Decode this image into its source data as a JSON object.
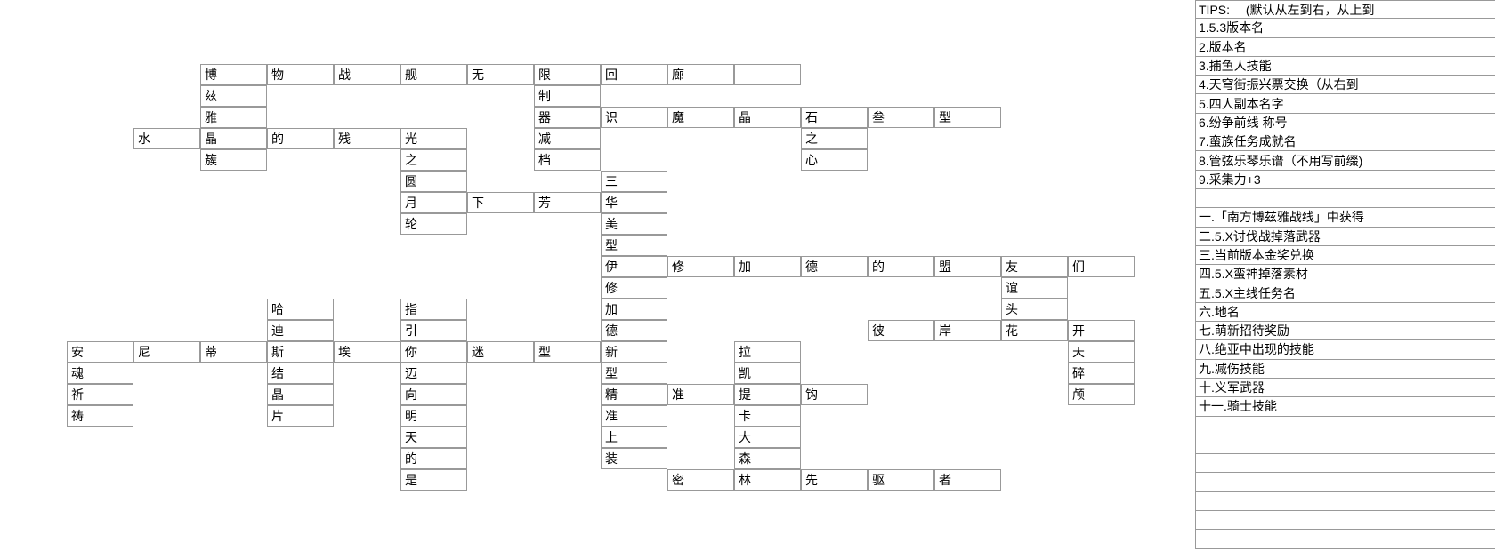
{
  "crossword": {
    "cells": [
      {
        "c": 3,
        "r": 3,
        "t": "博"
      },
      {
        "c": 4,
        "r": 3,
        "t": "物"
      },
      {
        "c": 5,
        "r": 3,
        "t": "战"
      },
      {
        "c": 6,
        "r": 3,
        "t": "舰"
      },
      {
        "c": 7,
        "r": 3,
        "t": "无"
      },
      {
        "c": 8,
        "r": 3,
        "t": "限"
      },
      {
        "c": 9,
        "r": 3,
        "t": "回"
      },
      {
        "c": 10,
        "r": 3,
        "t": "廊"
      },
      {
        "c": 11,
        "r": 3,
        "t": ""
      },
      {
        "c": 3,
        "r": 4,
        "t": "兹"
      },
      {
        "c": 8,
        "r": 4,
        "t": "制"
      },
      {
        "c": 3,
        "r": 5,
        "t": "雅"
      },
      {
        "c": 8,
        "r": 5,
        "t": "器"
      },
      {
        "c": 9,
        "r": 5,
        "t": "识"
      },
      {
        "c": 10,
        "r": 5,
        "t": "魔"
      },
      {
        "c": 11,
        "r": 5,
        "t": "晶"
      },
      {
        "c": 12,
        "r": 5,
        "t": "石"
      },
      {
        "c": 13,
        "r": 5,
        "t": "叁"
      },
      {
        "c": 14,
        "r": 5,
        "t": "型"
      },
      {
        "c": 2,
        "r": 6,
        "t": "水"
      },
      {
        "c": 3,
        "r": 6,
        "t": "晶"
      },
      {
        "c": 4,
        "r": 6,
        "t": "的"
      },
      {
        "c": 5,
        "r": 6,
        "t": "残"
      },
      {
        "c": 6,
        "r": 6,
        "t": "光"
      },
      {
        "c": 8,
        "r": 6,
        "t": "减"
      },
      {
        "c": 12,
        "r": 6,
        "t": "之"
      },
      {
        "c": 3,
        "r": 7,
        "t": "簇"
      },
      {
        "c": 6,
        "r": 7,
        "t": "之"
      },
      {
        "c": 8,
        "r": 7,
        "t": "档"
      },
      {
        "c": 12,
        "r": 7,
        "t": "心"
      },
      {
        "c": 6,
        "r": 8,
        "t": "圆"
      },
      {
        "c": 9,
        "r": 8,
        "t": "三"
      },
      {
        "c": 6,
        "r": 9,
        "t": "月"
      },
      {
        "c": 7,
        "r": 9,
        "t": "下"
      },
      {
        "c": 8,
        "r": 9,
        "t": "芳"
      },
      {
        "c": 9,
        "r": 9,
        "t": "华"
      },
      {
        "c": 6,
        "r": 10,
        "t": "轮"
      },
      {
        "c": 9,
        "r": 10,
        "t": "美"
      },
      {
        "c": 9,
        "r": 11,
        "t": "型"
      },
      {
        "c": 9,
        "r": 12,
        "t": "伊"
      },
      {
        "c": 10,
        "r": 12,
        "t": "修"
      },
      {
        "c": 11,
        "r": 12,
        "t": "加"
      },
      {
        "c": 12,
        "r": 12,
        "t": "德"
      },
      {
        "c": 13,
        "r": 12,
        "t": "的"
      },
      {
        "c": 14,
        "r": 12,
        "t": "盟"
      },
      {
        "c": 15,
        "r": 12,
        "t": "友"
      },
      {
        "c": 16,
        "r": 12,
        "t": "们"
      },
      {
        "c": 9,
        "r": 13,
        "t": "修"
      },
      {
        "c": 15,
        "r": 13,
        "t": "谊"
      },
      {
        "c": 4,
        "r": 14,
        "t": "哈"
      },
      {
        "c": 6,
        "r": 14,
        "t": "指"
      },
      {
        "c": 9,
        "r": 14,
        "t": "加"
      },
      {
        "c": 15,
        "r": 14,
        "t": "头"
      },
      {
        "c": 4,
        "r": 15,
        "t": "迪"
      },
      {
        "c": 6,
        "r": 15,
        "t": "引"
      },
      {
        "c": 9,
        "r": 15,
        "t": "德"
      },
      {
        "c": 13,
        "r": 15,
        "t": "彼"
      },
      {
        "c": 14,
        "r": 15,
        "t": "岸"
      },
      {
        "c": 15,
        "r": 15,
        "t": "花"
      },
      {
        "c": 16,
        "r": 15,
        "t": "开"
      },
      {
        "c": 1,
        "r": 16,
        "t": "安"
      },
      {
        "c": 2,
        "r": 16,
        "t": "尼"
      },
      {
        "c": 3,
        "r": 16,
        "t": "蒂"
      },
      {
        "c": 4,
        "r": 16,
        "t": "斯"
      },
      {
        "c": 5,
        "r": 16,
        "t": "埃"
      },
      {
        "c": 6,
        "r": 16,
        "t": "你"
      },
      {
        "c": 7,
        "r": 16,
        "t": "迷"
      },
      {
        "c": 8,
        "r": 16,
        "t": "型"
      },
      {
        "c": 9,
        "r": 16,
        "t": "新"
      },
      {
        "c": 11,
        "r": 16,
        "t": "拉"
      },
      {
        "c": 16,
        "r": 16,
        "t": "天"
      },
      {
        "c": 1,
        "r": 17,
        "t": "魂"
      },
      {
        "c": 4,
        "r": 17,
        "t": "结"
      },
      {
        "c": 6,
        "r": 17,
        "t": "迈"
      },
      {
        "c": 9,
        "r": 17,
        "t": "型"
      },
      {
        "c": 11,
        "r": 17,
        "t": "凯"
      },
      {
        "c": 16,
        "r": 17,
        "t": "碎"
      },
      {
        "c": 1,
        "r": 18,
        "t": "祈"
      },
      {
        "c": 4,
        "r": 18,
        "t": "晶"
      },
      {
        "c": 6,
        "r": 18,
        "t": "向"
      },
      {
        "c": 9,
        "r": 18,
        "t": "精"
      },
      {
        "c": 10,
        "r": 18,
        "t": "准"
      },
      {
        "c": 11,
        "r": 18,
        "t": "提"
      },
      {
        "c": 12,
        "r": 18,
        "t": "钩"
      },
      {
        "c": 16,
        "r": 18,
        "t": "颅"
      },
      {
        "c": 1,
        "r": 19,
        "t": "祷"
      },
      {
        "c": 4,
        "r": 19,
        "t": "片"
      },
      {
        "c": 6,
        "r": 19,
        "t": "明"
      },
      {
        "c": 9,
        "r": 19,
        "t": "准"
      },
      {
        "c": 11,
        "r": 19,
        "t": "卡"
      },
      {
        "c": 6,
        "r": 20,
        "t": "天"
      },
      {
        "c": 9,
        "r": 20,
        "t": "上"
      },
      {
        "c": 11,
        "r": 20,
        "t": "大"
      },
      {
        "c": 6,
        "r": 21,
        "t": "的"
      },
      {
        "c": 9,
        "r": 21,
        "t": "装"
      },
      {
        "c": 11,
        "r": 21,
        "t": "森"
      },
      {
        "c": 6,
        "r": 22,
        "t": "是"
      },
      {
        "c": 10,
        "r": 22,
        "t": "密"
      },
      {
        "c": 11,
        "r": 22,
        "t": "林"
      },
      {
        "c": 12,
        "r": 22,
        "t": "先"
      },
      {
        "c": 13,
        "r": 22,
        "t": "驱"
      },
      {
        "c": 14,
        "r": 22,
        "t": "者"
      }
    ]
  },
  "tips": {
    "header": "TIPS:　 (默认从左到右，从上到",
    "rows": [
      "1.5.3版本名",
      "2.版本名",
      "3.捕鱼人技能",
      "4.天穹街振兴票交换（从右到",
      "5.四人副本名字",
      "6.纷争前线 称号",
      "7.蛮族任务成就名",
      "8.管弦乐琴乐谱（不用写前缀)",
      "9.采集力+3",
      "",
      "一.「南方博兹雅战线」中获得",
      "二.5.X讨伐战掉落武器",
      "三.当前版本金奖兑换",
      "四.5.X蛮神掉落素材",
      "五.5.X主线任务名",
      "六.地名",
      "七.萌新招待奖励",
      "八.绝亚中出现的技能",
      "九.减伤技能",
      "十.义军武器",
      "十一.骑士技能",
      "",
      "",
      "",
      "",
      "",
      "",
      ""
    ]
  }
}
